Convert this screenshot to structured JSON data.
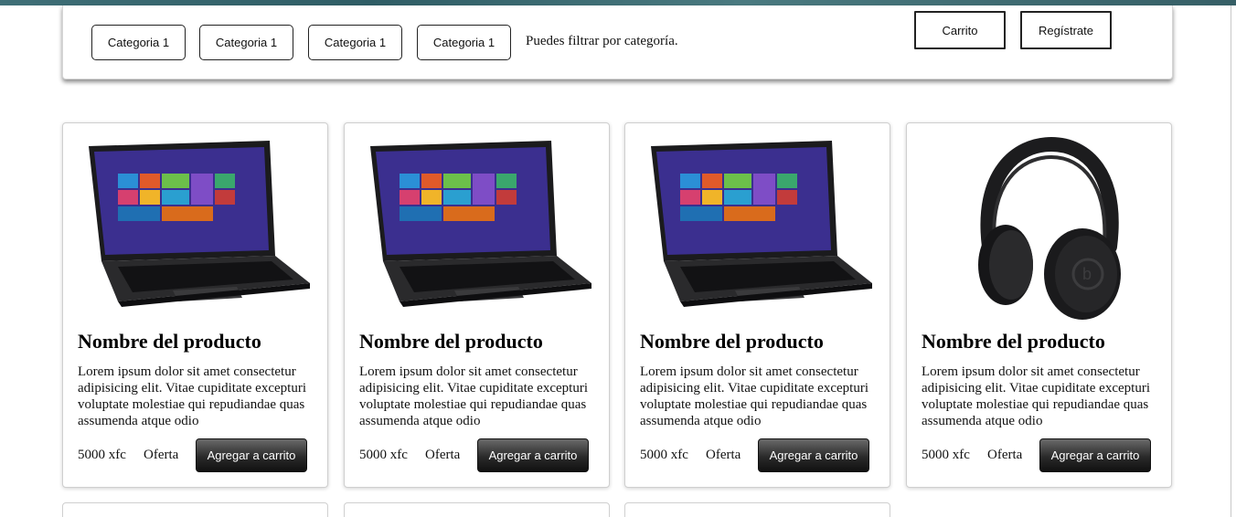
{
  "header": {
    "categories": [
      "Categoria 1",
      "Categoria 1",
      "Categoria 1",
      "Categoria 1"
    ],
    "filter_hint": "Puedes filtrar por categoría.",
    "cart_label": "Carrito",
    "register_label": "Regístrate"
  },
  "products": [
    {
      "image": "laptop-image",
      "name": "Nombre del producto",
      "description": "Lorem ipsum dolor sit amet consectetur adipisicing elit. Vitae cupiditate excepturi voluptate molestiae qui repudiandae quas assumenda atque odio",
      "price": "5000 xfc",
      "offer": "Oferta",
      "add_label": "Agregar a carrito"
    },
    {
      "image": "laptop-image",
      "name": "Nombre del producto",
      "description": "Lorem ipsum dolor sit amet consectetur adipisicing elit. Vitae cupiditate excepturi voluptate molestiae qui repudiandae quas assumenda atque odio",
      "price": "5000 xfc",
      "offer": "Oferta",
      "add_label": "Agregar a carrito"
    },
    {
      "image": "laptop-image",
      "name": "Nombre del producto",
      "description": "Lorem ipsum dolor sit amet consectetur adipisicing elit. Vitae cupiditate excepturi voluptate molestiae qui repudiandae quas assumenda atque odio",
      "price": "5000 xfc",
      "offer": "Oferta",
      "add_label": "Agregar a carrito"
    },
    {
      "image": "headphones-image",
      "name": "Nombre del producto",
      "description": "Lorem ipsum dolor sit amet consectetur adipisicing elit. Vitae cupiditate excepturi voluptate molestiae qui repudiandae quas assumenda atque odio",
      "price": "5000 xfc",
      "offer": "Oferta",
      "add_label": "Agregar a carrito"
    }
  ],
  "colors": {
    "top_strip": "#365f66",
    "button_dark": "#2a2a2a",
    "laptop_screen": "#3b2f8f"
  }
}
